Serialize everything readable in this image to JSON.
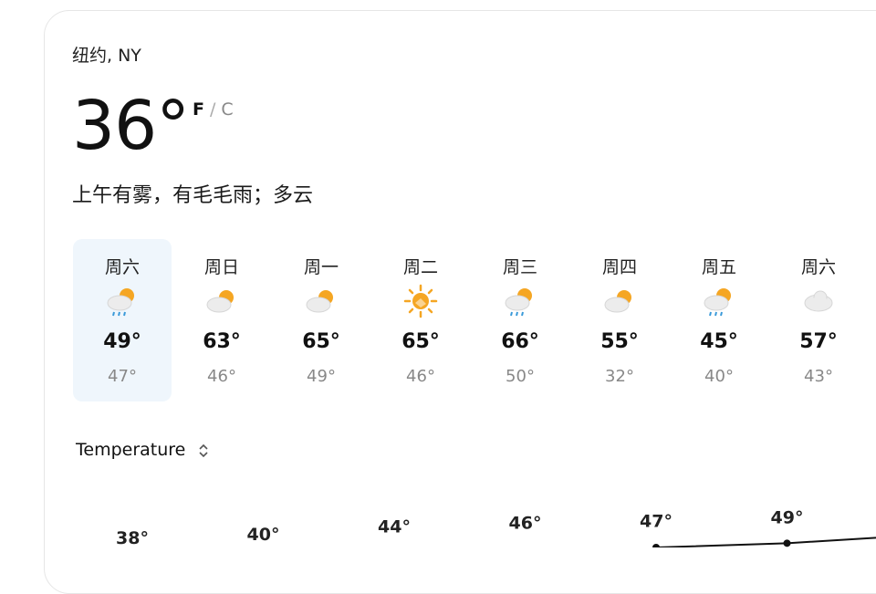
{
  "location": "纽约, NY",
  "current": {
    "temp": "36°",
    "unit_f": "F",
    "unit_sep": "/",
    "unit_c": "C",
    "condition": "上午有雾，有毛毛雨；多云"
  },
  "forecast": [
    {
      "day": "周六",
      "icon": "rain-partly-cloudy-icon",
      "high": "49°",
      "low": "47°",
      "selected": true
    },
    {
      "day": "周日",
      "icon": "partly-cloudy-icon",
      "high": "63°",
      "low": "46°"
    },
    {
      "day": "周一",
      "icon": "partly-cloudy-icon",
      "high": "65°",
      "low": "49°"
    },
    {
      "day": "周二",
      "icon": "sunny-icon",
      "high": "65°",
      "low": "46°"
    },
    {
      "day": "周三",
      "icon": "rain-partly-cloudy-icon",
      "high": "66°",
      "low": "50°"
    },
    {
      "day": "周四",
      "icon": "partly-cloudy-icon",
      "high": "55°",
      "low": "32°"
    },
    {
      "day": "周五",
      "icon": "rain-partly-cloudy-icon",
      "high": "45°",
      "low": "40°"
    },
    {
      "day": "周六",
      "icon": "cloudy-icon",
      "high": "57°",
      "low": "43°"
    }
  ],
  "metric_selector": {
    "label": "Temperature",
    "icon": "chevron-updown-icon"
  },
  "colors": {
    "sun": "#f5a623",
    "cloud": "#e8e8e8",
    "rain": "#3a9ad9",
    "selected_bg": "#eff6fc",
    "chart_line": "#111111"
  },
  "chart_data": {
    "type": "line",
    "x": [
      1,
      2,
      3,
      4,
      5,
      6
    ],
    "labels": [
      "38°",
      "40°",
      "44°",
      "46°",
      "47°",
      "49°"
    ],
    "values": [
      38,
      40,
      44,
      46,
      47,
      49
    ]
  }
}
